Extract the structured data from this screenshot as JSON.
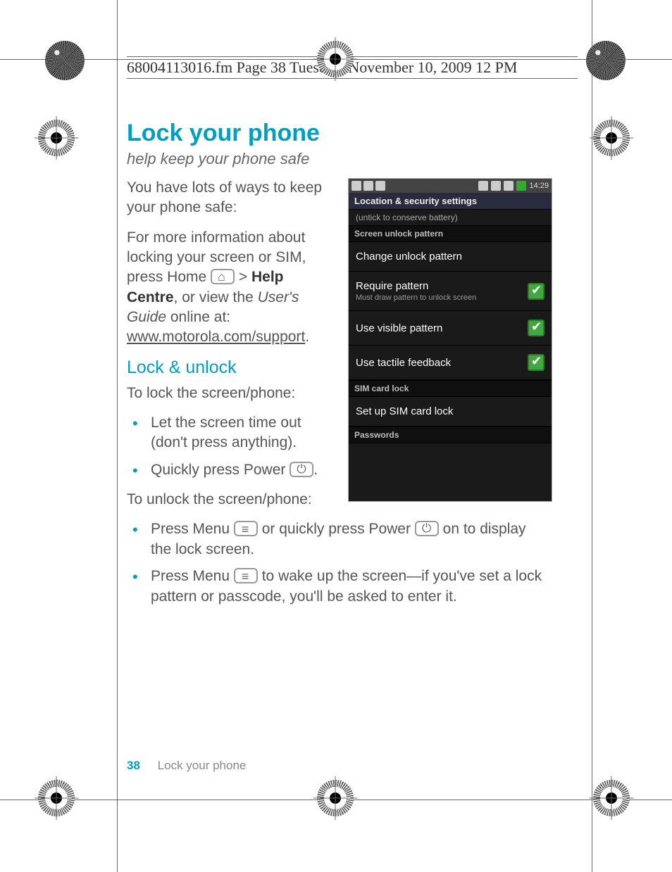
{
  "print_header": "68004113016.fm  Page 38  Tuesday, November 10, 2009  12    PM",
  "title": "Lock your phone",
  "subtitle": "help keep your phone safe",
  "intro1": "You have lots of ways to keep your phone safe:",
  "intro2_a": "For more information about locking your screen or SIM, press Home ",
  "intro2_b": " > ",
  "help_centre": "Help Centre",
  "intro2_c": ", or view the ",
  "users_guide": "User's Guide",
  "intro2_d": " online at:",
  "support_url": "www.motorola.com/support",
  "period": ".",
  "h2": "Lock & unlock",
  "lock_intro": "To lock the screen/phone:",
  "lock_b1": "Let the screen time out (don't press anything).",
  "lock_b2_a": "Quickly press Power ",
  "lock_b2_b": ".",
  "unlock_intro": "To unlock the screen/phone:",
  "unlock_b1_a": "Press Menu ",
  "unlock_b1_b": " or quickly press Power ",
  "unlock_b1_c": " on to display the lock screen.",
  "unlock_b2_a": "Press Menu ",
  "unlock_b2_b": " to wake up the screen—if you've set a lock pattern or passcode, you'll be asked to enter it.",
  "footer_page": "38",
  "footer_label": "Lock your phone",
  "phone": {
    "time": "14:29",
    "titlebar": "Location & security settings",
    "hint": "(untick to conserve battery)",
    "section1": "Screen unlock pattern",
    "item1": "Change unlock pattern",
    "item2": "Require pattern",
    "item2_sub": "Must draw pattern to unlock screen",
    "item3": "Use visible pattern",
    "item4": "Use tactile feedback",
    "section2": "SIM card lock",
    "item5": "Set up SIM card lock",
    "section3": "Passwords"
  }
}
